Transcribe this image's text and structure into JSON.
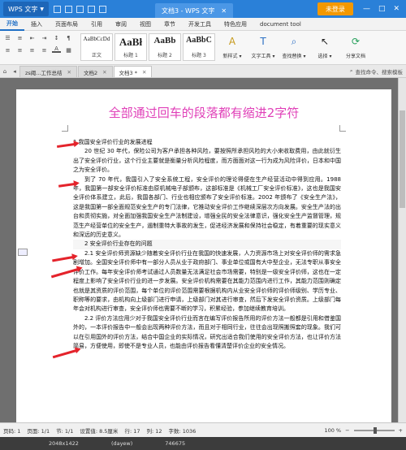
{
  "titlebar": {
    "app_name": "WPS 文字",
    "doc_tab": "文档3 - WPS 文字",
    "login": "未登录",
    "controls": [
      "—",
      "□",
      "✕"
    ]
  },
  "ribbon_tabs": [
    "开始",
    "插入",
    "页面布局",
    "引用",
    "审阅",
    "视图",
    "章节",
    "开发工具",
    "特色应用",
    "document tool"
  ],
  "ribbon": {
    "styles": [
      {
        "preview": "AaBbCcDd",
        "name": "正文"
      },
      {
        "preview": "AaBł",
        "name": "标题 1"
      },
      {
        "preview": "AaBb",
        "name": "标题 2"
      },
      {
        "preview": "AaBbC",
        "name": "标题 3"
      }
    ],
    "new_style": "新样式 ▾",
    "text_tool": "文字工具 ▾",
    "find_replace": "查找替换 ▾",
    "select": "选择 ▾",
    "share": "分享文档"
  },
  "doc_tabs": {
    "tabs": [
      "zs阈...工作总结",
      "文档2",
      "文档3 *"
    ],
    "find": "查找命令、搜索模板"
  },
  "document": {
    "title": "全部通过回车的段落都有缩进2字符",
    "paragraphs": [
      "1 我国安全评价行业的发展进程",
      "20 世纪 30 年代，保险公司为客户承担各种风险，要按照所承担风险的大小来收取费用，由此就衍生出了安全评价行业，这个行业主要就是衡量分析风险程度，而方面面对这一行为成为风险评价，日本和中国之为安全评价。",
      "到了 70 年代，我国引入了安全系统工程，安全评价的理论得便在生产经营活动中得到应用。1988 年，我国第一部安全评价标准由原机械电子部颁布，这部标准是《机械工厂安全评价标准》，这也是我国安全评价体系建立，此后，我国各部门、行业也相应颁布了安全评价标准。2002 年颁布了《安全生产法》，这是我国第一部全面规范安全生产的专门法律，它推动安全评价工作继续深层次方向发展。安全生产法的出台和贯彻实施，对全面加强我国安全生产法制建设，增强全民的安全法律意识，强化安全生产监督管理，规范生产经营单位的安全生产，遏制重特大事故的发生，促进经济发展和保持社会稳定，有着重要的现实意义和深远的历史意义。",
      "2 安全评价行业存在的问题",
      "2.1 安全评价师资源缺少随着安全评价行业在我国的快速发展，人力资源市场上对安全评价师的需求急剧增加。全国安全评价师中有一部分人员从业于政府部门、事业单位或国有大中型企业，无法专职从事安全评价工作。每年安全评价师考试通过人员数量无法满足社会市场需要，特别是一级安全评价师，这也在一定程度上影响了安全评价行业的进一步发展。安全评价机构需要在其能力范围内进行工作，其能力范围则确定也就是其资质的评价范围，每个单位的评价范围需要根据机构内从业安全评价师的评价师级别、学历专业、职称等的要求，由机构向上级部门进行申请，上级部门对其进行审查，然后下发安全评价资质。上级部门每年会对机构进行审查，安全评价师也需要不断的学习，积累经验，参加继续教育培训。",
      "2.2 评价方法应用少对于我国安全评价行业而言在编写评价报告所用的评价方法一般都是引用和借鉴国外的，一本评价报告中一般会出现两种评价方法，而且对于相同行业，往往会出现照搬照套的现象。我们可以在引用国外的评价方法，结合中国企业的实际情况，研究出适合我们使用的安全评价方法，也让评价方法简易，方便使用，即使不是专业人员，也能由评价报告看懂清楚评价企业的安全情况。"
    ]
  },
  "statusbar": {
    "page": "页码: 1",
    "pages": "页面: 1/1",
    "section": "节: 1/1",
    "settings": "设置值: 8.5厘米",
    "row": "行: 17",
    "col": "列: 12",
    "words": "字数: 1036",
    "zoom": "100 %"
  },
  "taskbar": [
    "2048x1422",
    "(dayew)",
    "746675"
  ],
  "watermark": "Baidu 经验"
}
